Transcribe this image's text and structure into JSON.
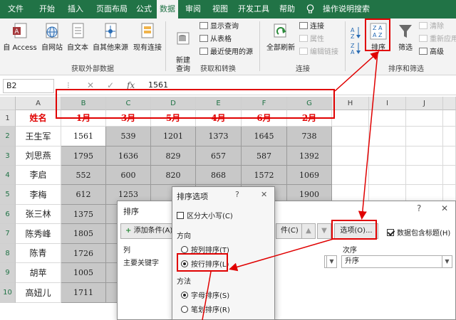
{
  "tabs": [
    "文件",
    "开始",
    "插入",
    "页面布局",
    "公式",
    "数据",
    "审阅",
    "视图",
    "开发工具",
    "帮助",
    "操作说明搜索"
  ],
  "active_tab": "数据",
  "ribbon": {
    "access": "自 Access",
    "web": "自网站",
    "text": "自文本",
    "other": "自其他来源",
    "existing": "现有连接",
    "group_external": "获取外部数据",
    "new_query": "新建\n查询",
    "show_queries": "显示查询",
    "from_table": "从表格",
    "recent_sources": "最近使用的源",
    "group_transform": "获取和转换",
    "refresh_all": "全部刷新",
    "connections": "连接",
    "properties": "属性",
    "edit_links": "编辑链接",
    "group_connections": "连接",
    "sort": "排序",
    "filter": "筛选",
    "clear": "清除",
    "reapply": "重新应用",
    "advanced": "高级",
    "group_sort_filter": "排序和筛选"
  },
  "formula_bar": {
    "name_box": "B2",
    "value": "1561"
  },
  "grid": {
    "col_headers": [
      "A",
      "B",
      "C",
      "D",
      "E",
      "F",
      "G",
      "H",
      "I",
      "J"
    ],
    "row_headers": [
      "1",
      "2",
      "3",
      "4",
      "5",
      "6",
      "7",
      "8",
      "9",
      "10"
    ],
    "header_row": [
      "姓名",
      "1月",
      "3月",
      "5月",
      "4月",
      "6月",
      "2月"
    ],
    "names": [
      "王生军",
      "刘思燕",
      "李启",
      "李梅",
      "张三林",
      "陈秀峰",
      "陈青",
      "胡苹",
      "高妞儿"
    ],
    "values": [
      [
        "1561",
        "539",
        "1201",
        "1373",
        "1645",
        "738"
      ],
      [
        "1795",
        "1636",
        "829",
        "657",
        "587",
        "1392"
      ],
      [
        "552",
        "600",
        "820",
        "868",
        "1572",
        "1069"
      ],
      [
        "612",
        "1253",
        "",
        "",
        "",
        "1900"
      ],
      [
        "1375",
        "",
        "",
        "",
        "",
        ""
      ],
      [
        "1805",
        "",
        "",
        "",
        "",
        ""
      ],
      [
        "1726",
        "",
        "",
        "",
        "",
        ""
      ],
      [
        "1005",
        "",
        "",
        "",
        "",
        ""
      ],
      [
        "1711",
        "",
        "",
        "",
        "",
        ""
      ]
    ]
  },
  "sort_dialog": {
    "title": "排序",
    "help": "?",
    "close": "✕",
    "add_level": "添加条件(A)",
    "copy_level_partial": "件(C)",
    "options": "选项(O)...",
    "has_headers": "数据包含标题(H)",
    "col_column": "列",
    "col_order": "次序",
    "primary_key": "主要关键字",
    "order_value": "升序"
  },
  "options_dialog": {
    "title": "排序选项",
    "help": "?",
    "close": "✕",
    "case_sensitive": "区分大小写(C)",
    "orientation_label": "方向",
    "top_to_bottom": "按列排序(T)",
    "left_to_right": "按行排序(L)",
    "method_label": "方法",
    "letter": "字母排序(S)",
    "stroke": "笔划排序(R)"
  },
  "colors": {
    "ribbon_green": "#217346",
    "annotation_red": "#e00000",
    "header_text_red": "#e00000",
    "selection_gray": "#c8c8c8"
  }
}
